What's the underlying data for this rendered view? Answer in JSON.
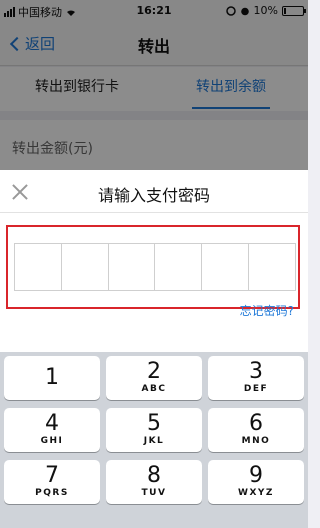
{
  "status_bar": {
    "carrier": "中国移动",
    "time": "16:21",
    "battery_text": "10%",
    "battery_level": 0.1
  },
  "nav": {
    "back_label": "返回",
    "title": "转出"
  },
  "tabs": [
    {
      "label": "转出到银行卡",
      "active": false
    },
    {
      "label": "转出到余额",
      "active": true
    }
  ],
  "amount": {
    "label": "转出金额(元)"
  },
  "password_modal": {
    "title": "请输入支付密码",
    "digit_count": 6,
    "forgot_label": "忘记密码?"
  },
  "keypad": {
    "keys": [
      {
        "num": "1",
        "letters": ""
      },
      {
        "num": "2",
        "letters": "ABC"
      },
      {
        "num": "3",
        "letters": "DEF"
      },
      {
        "num": "4",
        "letters": "GHI"
      },
      {
        "num": "5",
        "letters": "JKL"
      },
      {
        "num": "6",
        "letters": "MNO"
      },
      {
        "num": "7",
        "letters": "PQRS"
      },
      {
        "num": "8",
        "letters": "TUV"
      },
      {
        "num": "9",
        "letters": "WXYZ"
      }
    ]
  },
  "colors": {
    "accent": "#1e78d8",
    "highlight": "#d9252b"
  }
}
